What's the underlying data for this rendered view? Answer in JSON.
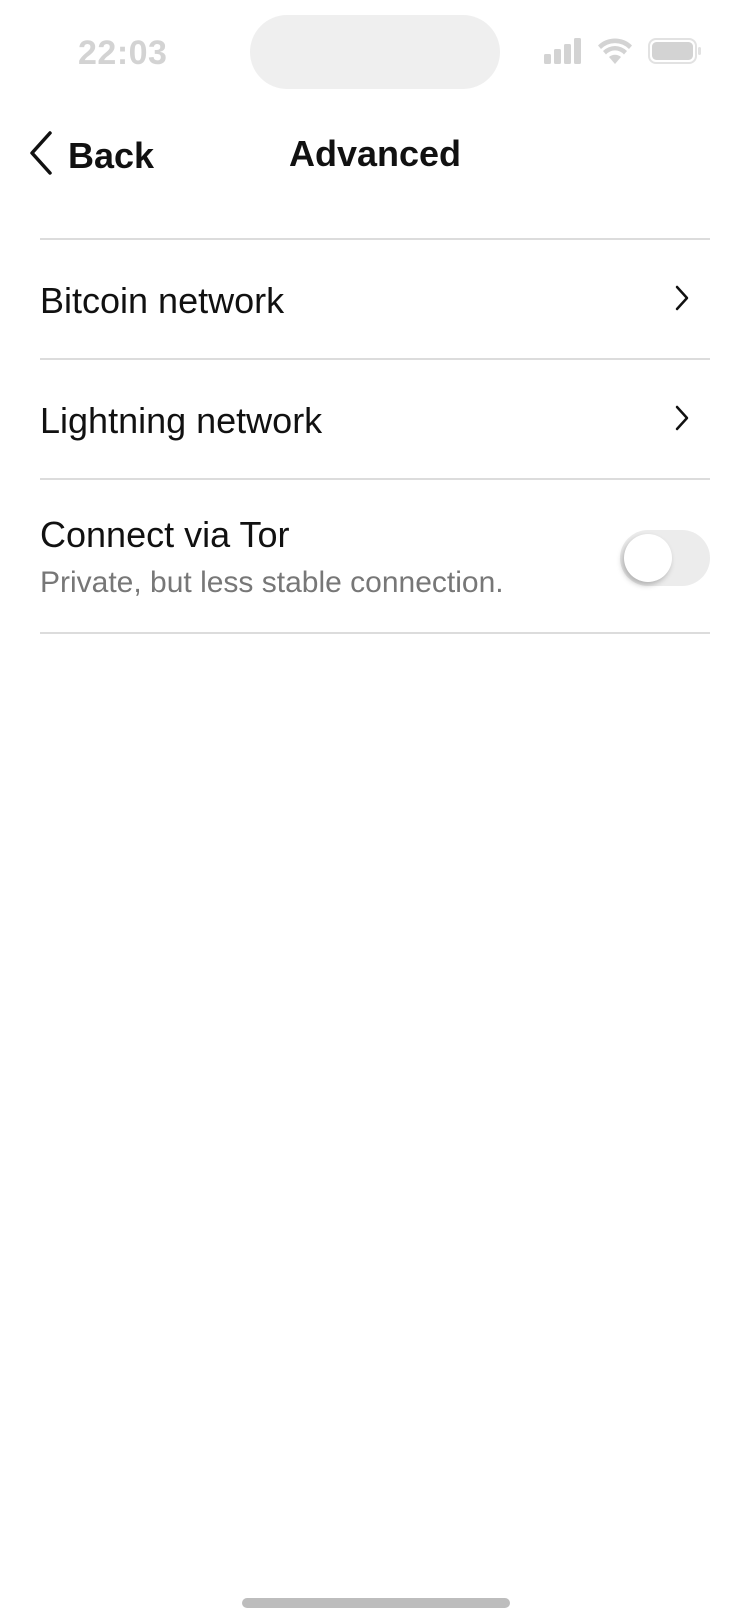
{
  "status_bar": {
    "time": "22:03",
    "icons": [
      "cellular-signal-icon",
      "wifi-icon",
      "battery-icon"
    ]
  },
  "nav": {
    "back_label": "Back",
    "title": "Advanced",
    "back_icon": "chevron-left-icon"
  },
  "settings": {
    "items": [
      {
        "label": "Bitcoin network",
        "icon": "chevron-right-icon"
      },
      {
        "label": "Lightning network",
        "icon": "chevron-right-icon"
      },
      {
        "label": "Connect via Tor",
        "subtitle": "Private, but less stable connection.",
        "toggle_on": false
      }
    ]
  },
  "colors": {
    "text": "#111111",
    "secondary_text": "#777777",
    "divider": "#dcdcdc",
    "toggle_off": "#ececec",
    "status_gray": "#d3d3d3"
  }
}
